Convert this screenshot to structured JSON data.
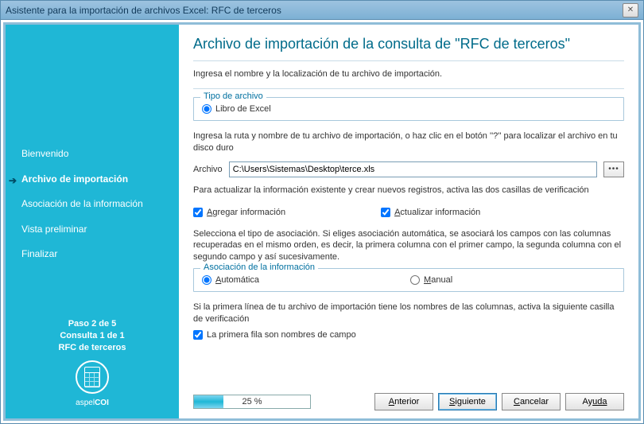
{
  "window": {
    "title": "Asistente para la importación de archivos Excel: RFC de terceros"
  },
  "sidebar": {
    "items": [
      {
        "label": "Bienvenido"
      },
      {
        "label": "Archivo de importación"
      },
      {
        "label": "Asociación de la información"
      },
      {
        "label": "Vista preliminar"
      },
      {
        "label": "Finalizar"
      }
    ],
    "active_index": 1,
    "step": "Paso 2 de 5",
    "consult": "Consulta 1 de 1",
    "subject": "RFC de terceros",
    "brand_prefix": "aspel",
    "brand_suffix": "COI"
  },
  "main": {
    "heading": "Archivo de importación de la consulta de \"RFC de terceros\"",
    "intro": "Ingresa el nombre y la localización de tu archivo de importación.",
    "file_type_legend": "Tipo de archivo",
    "file_type_options": {
      "excel": "Libro de Excel"
    },
    "path_hint": "Ingresa la ruta y nombre de tu archivo de importación, o haz clic en el botón ''?'' para localizar el archivo en tu disco duro",
    "path_label": "Archivo",
    "path_value": "C:\\Users\\Sistemas\\Desktop\\terce.xls",
    "browse_label": "•••",
    "update_hint": "Para actualizar la información existente y crear nuevos registros, activa las dos casillas de verificación",
    "checks": {
      "add_prefix": "A",
      "add_rest": "gregar información",
      "update_prefix": "A",
      "update_rest": "ctualizar información"
    },
    "assoc_para": "Selecciona el tipo de asociación. Si eliges asociación automática, se asociará los campos con las columnas recuperadas en el mismo orden, es decir, la primera columna con el primer campo, la segunda columna con el segundo campo y así sucesivamente.",
    "assoc_legend": "Asociación de la información",
    "assoc": {
      "auto_prefix": "A",
      "auto_rest": "utomática",
      "manual_prefix": "M",
      "manual_rest": "anual"
    },
    "firstrow_hint": "Si la primera línea de tu archivo de importación tiene los nombres de las columnas, activa la siguiente casilla de verificación",
    "firstrow_check": "La primera fila son nombres de campo"
  },
  "footer": {
    "progress_percent": 25,
    "progress_label": "25 %",
    "buttons": {
      "back_prefix": "A",
      "back_rest": "nterior",
      "next_prefix": "S",
      "next_rest": "iguiente",
      "cancel_prefix": "C",
      "cancel_rest": "ancelar",
      "help_prefix": "Ay",
      "help_rest": "uda"
    }
  }
}
